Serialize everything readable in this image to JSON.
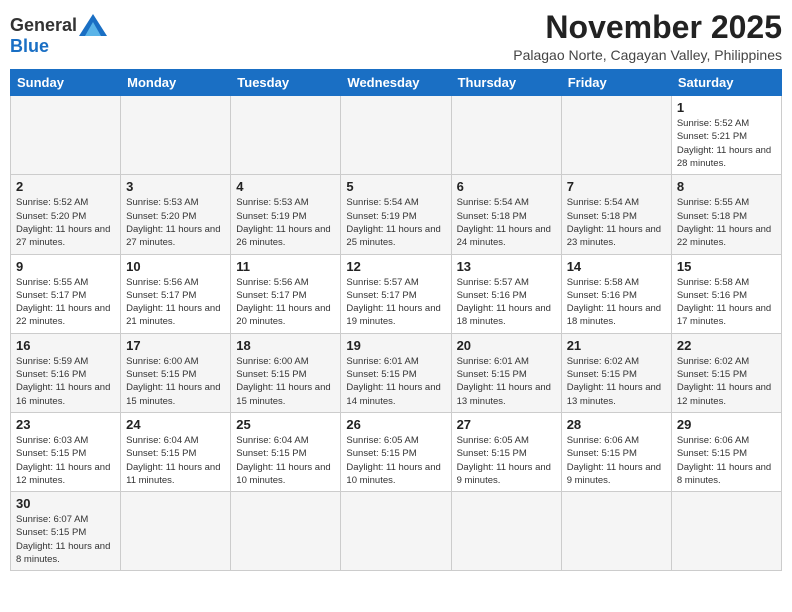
{
  "logo": {
    "general": "General",
    "blue": "Blue"
  },
  "header": {
    "title": "November 2025",
    "subtitle": "Palagao Norte, Cagayan Valley, Philippines"
  },
  "weekdays": [
    "Sunday",
    "Monday",
    "Tuesday",
    "Wednesday",
    "Thursday",
    "Friday",
    "Saturday"
  ],
  "weeks": [
    [
      {
        "day": "",
        "info": ""
      },
      {
        "day": "",
        "info": ""
      },
      {
        "day": "",
        "info": ""
      },
      {
        "day": "",
        "info": ""
      },
      {
        "day": "",
        "info": ""
      },
      {
        "day": "",
        "info": ""
      },
      {
        "day": "1",
        "info": "Sunrise: 5:52 AM\nSunset: 5:21 PM\nDaylight: 11 hours\nand 28 minutes."
      }
    ],
    [
      {
        "day": "2",
        "info": "Sunrise: 5:52 AM\nSunset: 5:20 PM\nDaylight: 11 hours\nand 27 minutes."
      },
      {
        "day": "3",
        "info": "Sunrise: 5:53 AM\nSunset: 5:20 PM\nDaylight: 11 hours\nand 27 minutes."
      },
      {
        "day": "4",
        "info": "Sunrise: 5:53 AM\nSunset: 5:19 PM\nDaylight: 11 hours\nand 26 minutes."
      },
      {
        "day": "5",
        "info": "Sunrise: 5:54 AM\nSunset: 5:19 PM\nDaylight: 11 hours\nand 25 minutes."
      },
      {
        "day": "6",
        "info": "Sunrise: 5:54 AM\nSunset: 5:18 PM\nDaylight: 11 hours\nand 24 minutes."
      },
      {
        "day": "7",
        "info": "Sunrise: 5:54 AM\nSunset: 5:18 PM\nDaylight: 11 hours\nand 23 minutes."
      },
      {
        "day": "8",
        "info": "Sunrise: 5:55 AM\nSunset: 5:18 PM\nDaylight: 11 hours\nand 22 minutes."
      }
    ],
    [
      {
        "day": "9",
        "info": "Sunrise: 5:55 AM\nSunset: 5:17 PM\nDaylight: 11 hours\nand 22 minutes."
      },
      {
        "day": "10",
        "info": "Sunrise: 5:56 AM\nSunset: 5:17 PM\nDaylight: 11 hours\nand 21 minutes."
      },
      {
        "day": "11",
        "info": "Sunrise: 5:56 AM\nSunset: 5:17 PM\nDaylight: 11 hours\nand 20 minutes."
      },
      {
        "day": "12",
        "info": "Sunrise: 5:57 AM\nSunset: 5:17 PM\nDaylight: 11 hours\nand 19 minutes."
      },
      {
        "day": "13",
        "info": "Sunrise: 5:57 AM\nSunset: 5:16 PM\nDaylight: 11 hours\nand 18 minutes."
      },
      {
        "day": "14",
        "info": "Sunrise: 5:58 AM\nSunset: 5:16 PM\nDaylight: 11 hours\nand 18 minutes."
      },
      {
        "day": "15",
        "info": "Sunrise: 5:58 AM\nSunset: 5:16 PM\nDaylight: 11 hours\nand 17 minutes."
      }
    ],
    [
      {
        "day": "16",
        "info": "Sunrise: 5:59 AM\nSunset: 5:16 PM\nDaylight: 11 hours\nand 16 minutes."
      },
      {
        "day": "17",
        "info": "Sunrise: 6:00 AM\nSunset: 5:15 PM\nDaylight: 11 hours\nand 15 minutes."
      },
      {
        "day": "18",
        "info": "Sunrise: 6:00 AM\nSunset: 5:15 PM\nDaylight: 11 hours\nand 15 minutes."
      },
      {
        "day": "19",
        "info": "Sunrise: 6:01 AM\nSunset: 5:15 PM\nDaylight: 11 hours\nand 14 minutes."
      },
      {
        "day": "20",
        "info": "Sunrise: 6:01 AM\nSunset: 5:15 PM\nDaylight: 11 hours\nand 13 minutes."
      },
      {
        "day": "21",
        "info": "Sunrise: 6:02 AM\nSunset: 5:15 PM\nDaylight: 11 hours\nand 13 minutes."
      },
      {
        "day": "22",
        "info": "Sunrise: 6:02 AM\nSunset: 5:15 PM\nDaylight: 11 hours\nand 12 minutes."
      }
    ],
    [
      {
        "day": "23",
        "info": "Sunrise: 6:03 AM\nSunset: 5:15 PM\nDaylight: 11 hours\nand 12 minutes."
      },
      {
        "day": "24",
        "info": "Sunrise: 6:04 AM\nSunset: 5:15 PM\nDaylight: 11 hours\nand 11 minutes."
      },
      {
        "day": "25",
        "info": "Sunrise: 6:04 AM\nSunset: 5:15 PM\nDaylight: 11 hours\nand 10 minutes."
      },
      {
        "day": "26",
        "info": "Sunrise: 6:05 AM\nSunset: 5:15 PM\nDaylight: 11 hours\nand 10 minutes."
      },
      {
        "day": "27",
        "info": "Sunrise: 6:05 AM\nSunset: 5:15 PM\nDaylight: 11 hours\nand 9 minutes."
      },
      {
        "day": "28",
        "info": "Sunrise: 6:06 AM\nSunset: 5:15 PM\nDaylight: 11 hours\nand 9 minutes."
      },
      {
        "day": "29",
        "info": "Sunrise: 6:06 AM\nSunset: 5:15 PM\nDaylight: 11 hours\nand 8 minutes."
      }
    ],
    [
      {
        "day": "30",
        "info": "Sunrise: 6:07 AM\nSunset: 5:15 PM\nDaylight: 11 hours\nand 8 minutes."
      },
      {
        "day": "",
        "info": ""
      },
      {
        "day": "",
        "info": ""
      },
      {
        "day": "",
        "info": ""
      },
      {
        "day": "",
        "info": ""
      },
      {
        "day": "",
        "info": ""
      },
      {
        "day": "",
        "info": ""
      }
    ]
  ]
}
